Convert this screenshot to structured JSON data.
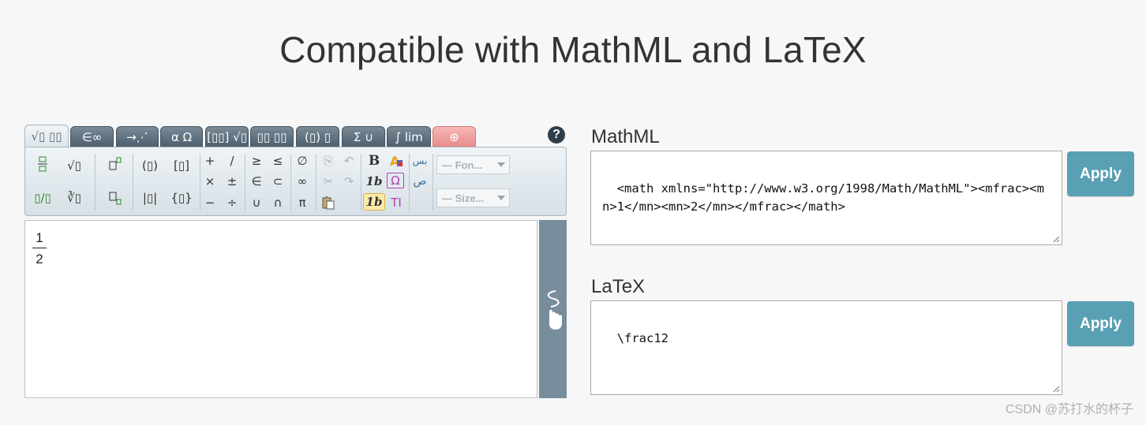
{
  "header": {
    "title": "Compatible with MathML and LaTeX"
  },
  "editor": {
    "tabs": [
      "√▯ ▯▯",
      "∈∞",
      "→⋰",
      "α Ω",
      "[▯▯] √▯",
      "▯▯ ▯▯",
      "(▯) ▯",
      "Σ ∪",
      "∫ lim",
      "⊕"
    ],
    "toolbar": {
      "frac": [
        "▯/▯",
        "▯⁄▯"
      ],
      "roots": [
        "√▯",
        "∛▯"
      ],
      "scripts": [
        "▯▯",
        "▯▯"
      ],
      "brackets": [
        "(▯)",
        "[▯]",
        "|▯|",
        "{▯}"
      ],
      "ops": [
        "+",
        "/",
        "×",
        "±",
        "−",
        "÷"
      ],
      "rel": [
        "≥",
        "≤",
        "∈",
        "⊂",
        "∪",
        "∩"
      ],
      "misc": [
        "∅",
        "∞",
        "π"
      ],
      "edit": [
        "⎘",
        "↶",
        "✂",
        "↷",
        "📋"
      ],
      "format": [
        "B",
        "A",
        "1b",
        "Ω",
        "1b",
        "TI"
      ],
      "rtl": [
        "بس",
        "ﺹ"
      ],
      "font_dropdown": "— Fon...",
      "size_dropdown": "— Size..."
    },
    "help": "?",
    "formula": {
      "numerator": "1",
      "denominator": "2"
    }
  },
  "mathml": {
    "label": "MathML",
    "value": "<math xmlns=\"http://www.w3.org/1998/Math/MathML\"><mfrac><mn>1</mn><mn>2</mn></mfrac></math>",
    "apply": "Apply"
  },
  "latex": {
    "label": "LaTeX",
    "value": "\\frac12",
    "apply": "Apply"
  },
  "watermark": "CSDN @苏打水的杯子"
}
